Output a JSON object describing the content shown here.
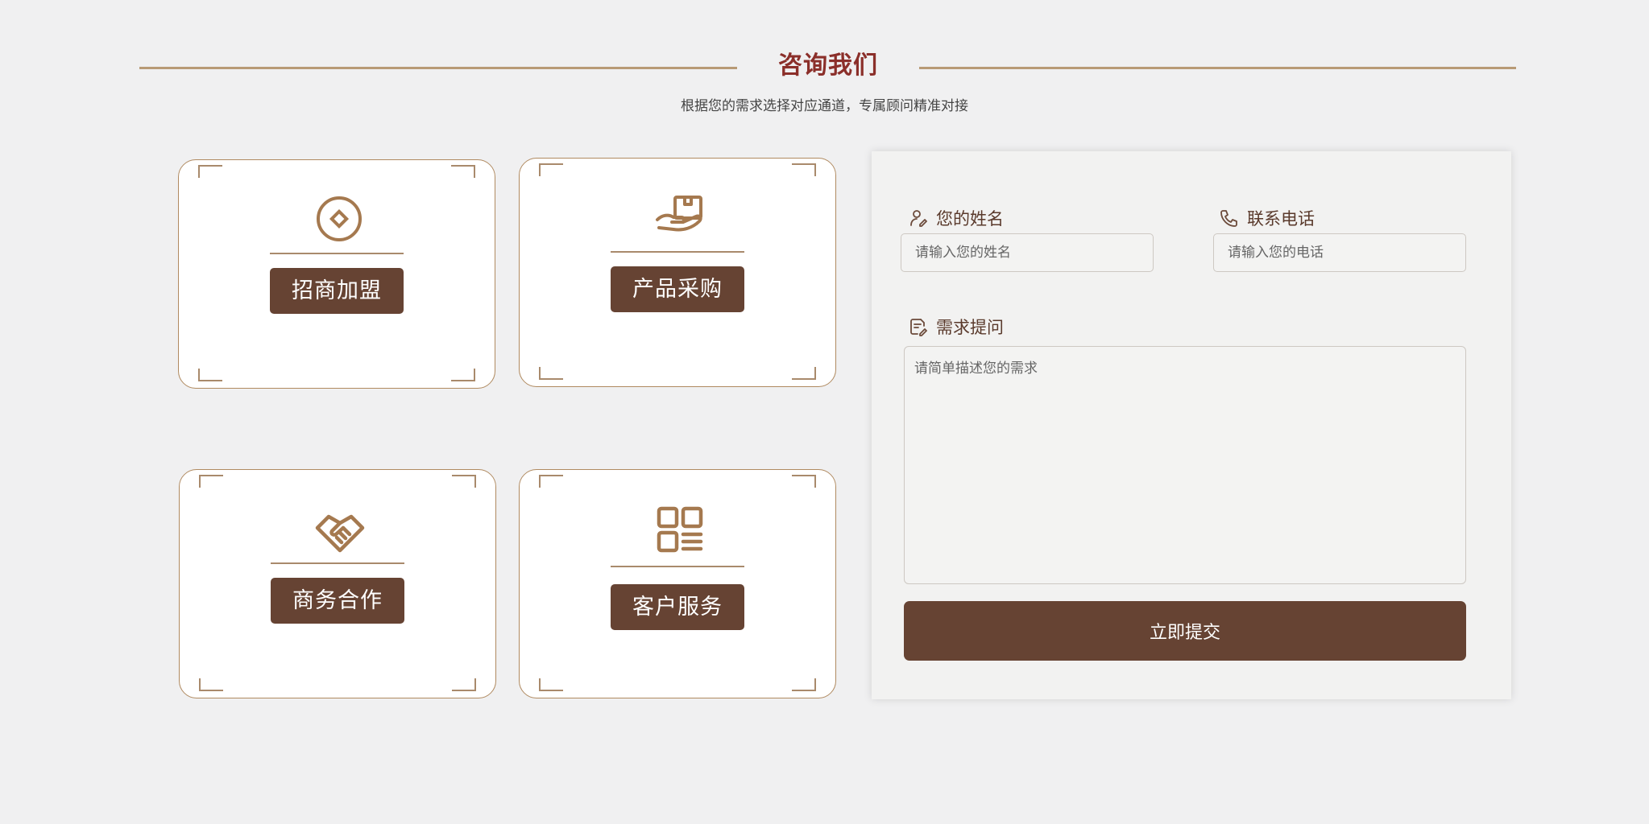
{
  "header": {
    "title": "咨询我们",
    "subtitle": "根据您的需求选择对应通道，专属顾问精准对接"
  },
  "cards": [
    {
      "label": "招商加盟",
      "icon": "coin-icon"
    },
    {
      "label": "产品采购",
      "icon": "hand-box-icon"
    },
    {
      "label": "商务合作",
      "icon": "handshake-icon"
    },
    {
      "label": "客户服务",
      "icon": "service-grid-icon"
    }
  ],
  "form": {
    "name": {
      "label": "您的姓名",
      "placeholder": "请输入您的姓名",
      "value": ""
    },
    "phone": {
      "label": "联系电话",
      "placeholder": "请输入您的电话",
      "value": ""
    },
    "request": {
      "label": "需求提问",
      "placeholder": "请简单描述您的需求",
      "value": ""
    },
    "submit_label": "立即提交"
  },
  "colors": {
    "accent": "#664333",
    "title": "#8b2f2a",
    "line": "#b89a76",
    "background": "#f0f0f1"
  }
}
